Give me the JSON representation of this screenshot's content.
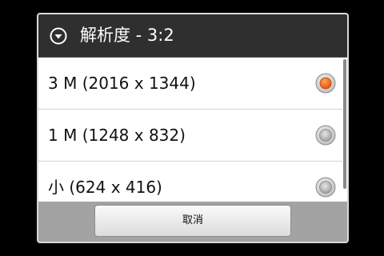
{
  "dialog": {
    "title": "解析度 - 3:2",
    "title_icon": "chevron-down-circle-icon",
    "options": [
      {
        "label": "3 M (2016 x 1344)",
        "selected": true
      },
      {
        "label": "1 M (1248 x 832)",
        "selected": false
      },
      {
        "label": "小 (624 x 416)",
        "selected": false
      }
    ],
    "cancel_label": "取消"
  },
  "colors": {
    "header_bg": "#2f2f2f",
    "footer_bg": "#a3a3a3",
    "radio_selected": "#f26b1d"
  }
}
